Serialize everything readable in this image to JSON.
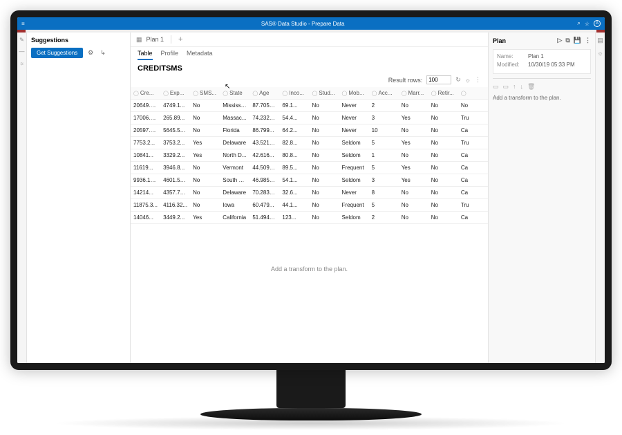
{
  "app": {
    "title": "SAS® Data Studio - Prepare Data",
    "userBadge": "A"
  },
  "leftPanel": {
    "header": "Suggestions",
    "buttonLabel": "Get Suggestions"
  },
  "tabs": {
    "planLabel": "Plan 1"
  },
  "subtabs": {
    "table": "Table",
    "profile": "Profile",
    "metadata": "Metadata"
  },
  "tableName": "CREDITSMS",
  "resultRows": {
    "label": "Result rows:",
    "value": "100"
  },
  "columns": [
    "Cre...",
    "Exp...",
    "SMS...",
    "State",
    "Age",
    "Inco...",
    "Stud...",
    "Mob...",
    "Acc...",
    "Marr...",
    "Retir...",
    ""
  ],
  "rows": [
    [
      "20649.1...",
      "4749.1...",
      "No",
      "Mississip...",
      "87.7054...",
      "69.1...",
      "No",
      "Never",
      "2",
      "No",
      "No",
      "No"
    ],
    [
      "17006.1...",
      "265.89...",
      "No",
      "Massac...",
      "74.2321...",
      "54.4...",
      "No",
      "Never",
      "3",
      "Yes",
      "No",
      "Tru"
    ],
    [
      "20597.9...",
      "5645.58...",
      "No",
      "Florida",
      "86.799...",
      "64.2...",
      "No",
      "Never",
      "10",
      "No",
      "No",
      "Ca"
    ],
    [
      "7753.2...",
      "3753.2...",
      "Yes",
      "Delaware",
      "43.5210...",
      "82.8...",
      "No",
      "Seldom",
      "5",
      "Yes",
      "No",
      "Tru"
    ],
    [
      "10841...",
      "3329.2...",
      "Yes",
      "North D...",
      "42.616...",
      "80.8...",
      "No",
      "Seldom",
      "1",
      "No",
      "No",
      "Ca"
    ],
    [
      "11619...",
      "3946.8...",
      "No",
      "Vermont",
      "44.5090...",
      "89.5...",
      "No",
      "Frequent",
      "5",
      "Yes",
      "No",
      "Ca"
    ],
    [
      "9936.12...",
      "4601.58...",
      "No",
      "South C...",
      "46.9855...",
      "54.1...",
      "No",
      "Seldom",
      "3",
      "Yes",
      "No",
      "Ca"
    ],
    [
      "14214...",
      "4357.76...",
      "No",
      "Delaware",
      "70.2834...",
      "32.6...",
      "No",
      "Never",
      "8",
      "No",
      "No",
      "Ca"
    ],
    [
      "11875.3...",
      "4116.32...",
      "No",
      "Iowa",
      "60.479...",
      "44.1...",
      "No",
      "Frequent",
      "5",
      "No",
      "No",
      "Tru"
    ],
    [
      "14046...",
      "3449.2...",
      "Yes",
      "California",
      "51.4942...",
      "123...",
      "No",
      "Seldom",
      "2",
      "No",
      "No",
      "Ca"
    ]
  ],
  "centerHint": "Add a transform to the plan.",
  "rightPanel": {
    "header": "Plan",
    "nameLabel": "Name:",
    "nameValue": "Plan 1",
    "modifiedLabel": "Modified:",
    "modifiedValue": "10/30/19 05:33 PM",
    "hint": "Add a transform to the plan."
  }
}
